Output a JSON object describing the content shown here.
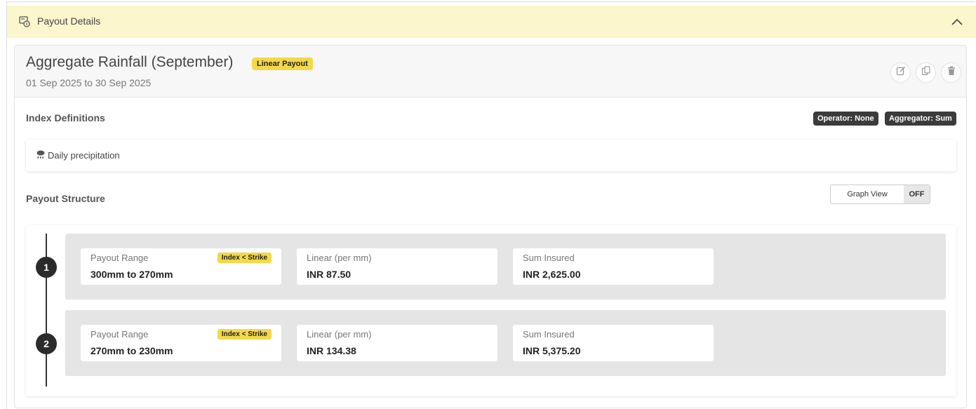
{
  "accordion": {
    "title": "Payout Details",
    "icon": "payout-document-icon",
    "expanded": true
  },
  "card": {
    "title": "Aggregate Rainfall (September)",
    "badge": "Linear Payout",
    "date_range": "01 Sep 2025 to 30 Sep 2025",
    "actions": [
      "edit-icon",
      "copy-icon",
      "delete-icon"
    ]
  },
  "index_definitions": {
    "title": "Index Definitions",
    "operator_badge": "Operator: None",
    "aggregator_badge": "Aggregator: Sum",
    "items": [
      {
        "icon": "rain-cloud-icon",
        "label": "Daily precipitation"
      }
    ]
  },
  "payout_structure": {
    "title": "Payout Structure",
    "toggle_label": "Graph View",
    "toggle_state": "OFF",
    "tiers": [
      {
        "step": "1",
        "range_label": "Payout Range",
        "range_badge": "Index < Strike",
        "range_value": "300mm to 270mm",
        "rate_label": "Linear (per mm)",
        "rate_value": "INR 87.50",
        "sum_label": "Sum Insured",
        "sum_value": "INR 2,625.00"
      },
      {
        "step": "2",
        "range_label": "Payout Range",
        "range_badge": "Index < Strike",
        "range_value": "270mm to 230mm",
        "rate_label": "Linear (per mm)",
        "rate_value": "INR 134.38",
        "sum_label": "Sum Insured",
        "sum_value": "INR 5,375.20"
      }
    ]
  },
  "colors": {
    "header_bg": "#fbf6cc",
    "badge_yellow": "#f3d84a",
    "dark_badge": "#3b3b3b",
    "tier_bg": "#e5e5e5"
  }
}
